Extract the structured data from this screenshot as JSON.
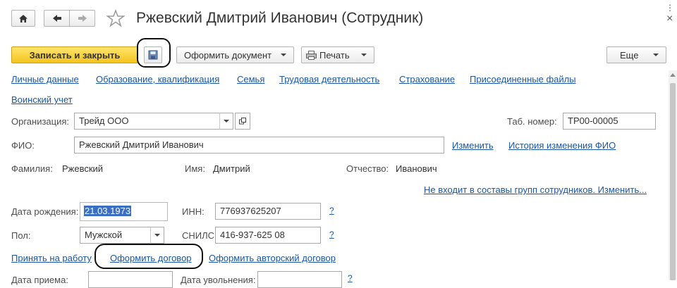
{
  "window": {
    "title": "Ржевский Дмитрий Иванович (Сотрудник)",
    "close_glyph": "×",
    "more_glyph": "⋮"
  },
  "toolbar": {
    "save_close_label": "Записать и закрыть",
    "issue_doc_label": "Оформить документ",
    "print_label": "Печать",
    "more_label": "Еще"
  },
  "tabs": [
    "Личные данные",
    "Образование, квалификация",
    "Семья",
    "Трудовая деятельность",
    "Страхование",
    "Присоединенные файлы",
    "Воинский учет"
  ],
  "form": {
    "org_label": "Организация:",
    "org_value": "Трейд ООО",
    "tab_num_label": "Таб. номер:",
    "tab_num_value": "ТР00-00005",
    "fio_label": "ФИО:",
    "fio_value": "Ржевский Дмитрий Иванович",
    "change_link": "Изменить",
    "fio_history_link": "История изменения ФИО",
    "surname_label": "Фамилия:",
    "surname_value": "Ржевский",
    "name_label": "Имя:",
    "name_value": "Дмитрий",
    "patronymic_label": "Отчество:",
    "patronymic_value": "Иванович",
    "groups_link": "Не входит в составы групп сотрудников. Изменить...",
    "birth_label": "Дата рождения:",
    "birth_value": "21.03.1973",
    "inn_label": "ИНН:",
    "inn_value": "776937625207",
    "gender_label": "Пол:",
    "gender_value": "Мужской",
    "snils_label": "СНИЛС:",
    "snils_value": "416-937-625 08",
    "help_glyph": "?",
    "hire_link": "Принять на работу",
    "contract_link": "Оформить договор",
    "author_contract_link": "Оформить авторский договор",
    "hire_date_label": "Дата приема:",
    "dismiss_date_label": "Дата увольнения:"
  }
}
